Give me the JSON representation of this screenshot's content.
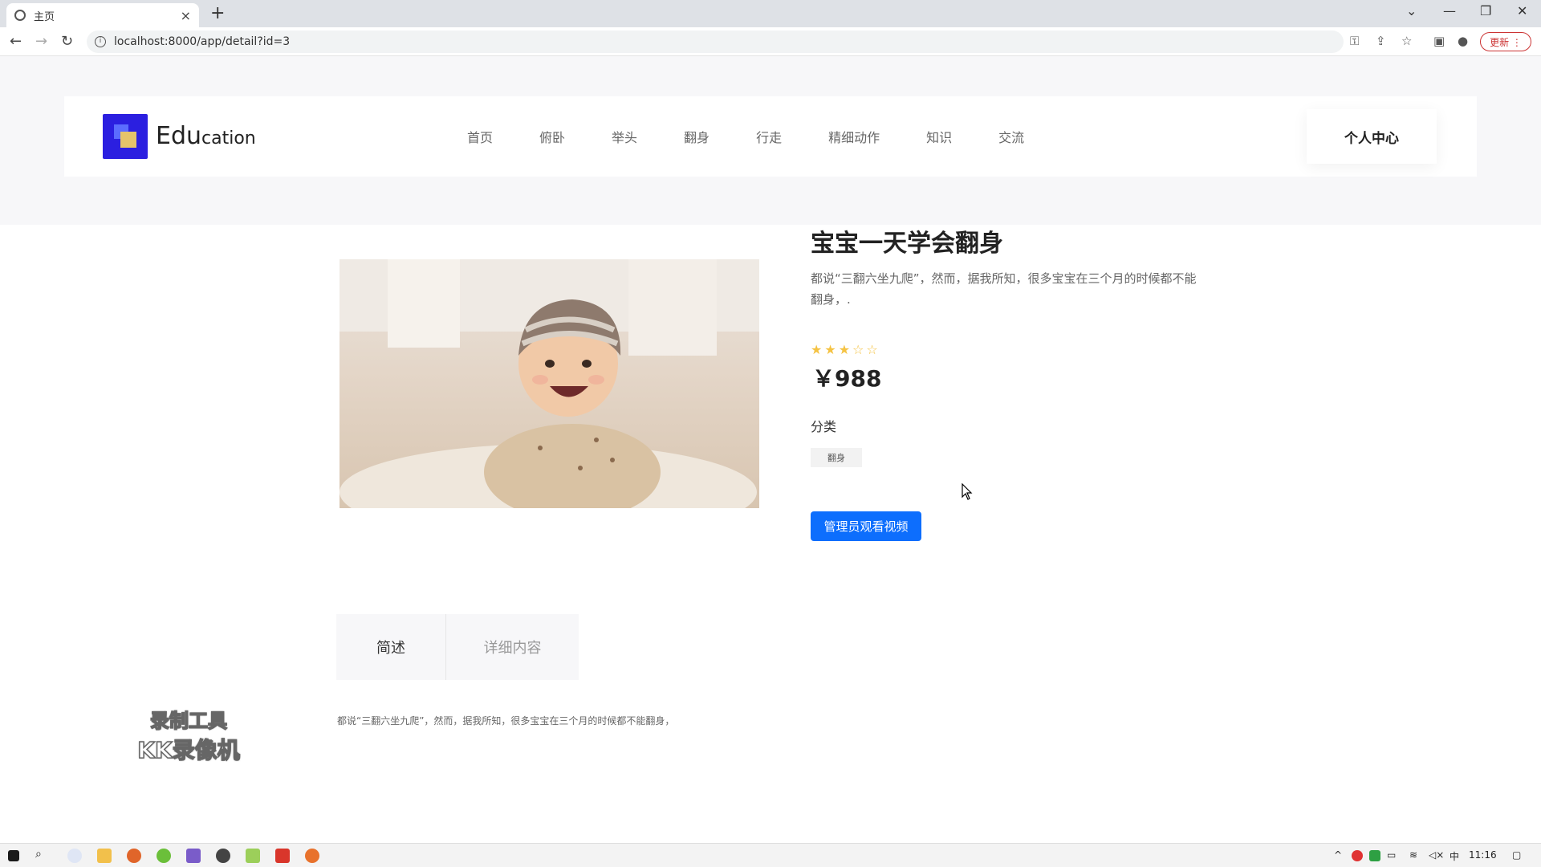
{
  "browser": {
    "tab_title": "主页",
    "tab_close": "×",
    "new_tab": "+",
    "url": "localhost:8000/app/detail?id=3",
    "update_label": "更新 ⋮"
  },
  "site": {
    "logo_main": "Edu",
    "logo_rest": "cation",
    "nav": [
      "首页",
      "俯卧",
      "举头",
      "翻身",
      "行走",
      "精细动作",
      "知识",
      "交流"
    ],
    "profile_label": "个人中心"
  },
  "product": {
    "title": "宝宝一天学会翻身",
    "description": "都说“三翻六坐九爬”，然而，据我所知，很多宝宝在三个月的时候都不能翻身，.",
    "rating": 3,
    "rating_max": 5,
    "price": "￥988",
    "category_label": "分类",
    "category_tag": "翻身",
    "watch_button": "管理员观看视频"
  },
  "content_tabs": {
    "tab1": "简述",
    "tab2": "详细内容",
    "body": "都说“三翻六坐九爬”，然而，据我所知，很多宝宝在三个月的时候都不能翻身，"
  },
  "watermark": {
    "line1": "录制工具",
    "line2": "KK录像机"
  },
  "taskbar": {
    "ime": "中",
    "clock": "11:16"
  },
  "colors": {
    "accent": "#0d6efd",
    "logo": "#2b1fe0",
    "star": "#f5c343"
  }
}
